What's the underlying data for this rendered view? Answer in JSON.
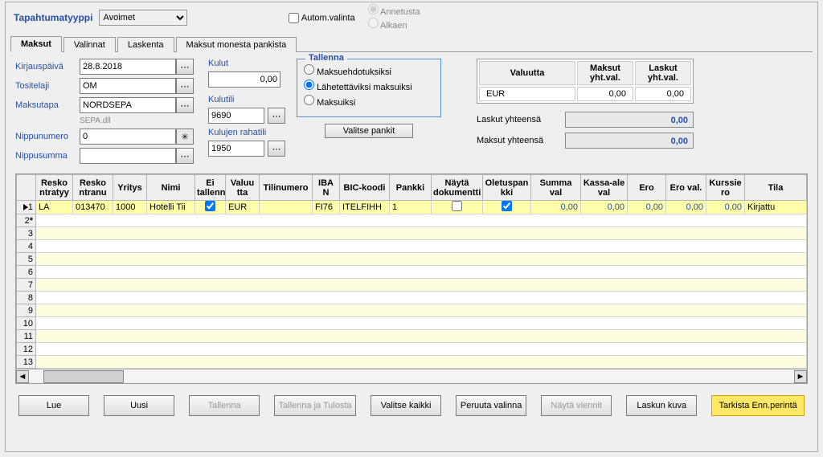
{
  "top": {
    "type_label": "Tapahtumatyyppi",
    "type_value": "Avoimet",
    "autoselect": "Autom.valinta",
    "radio1": "Annetusta",
    "radio2": "Alkaen"
  },
  "tabs": [
    "Maksut",
    "Valinnat",
    "Laskenta",
    "Maksut monesta pankista"
  ],
  "form": {
    "kirjauspaiva_label": "Kirjauspäivä",
    "kirjauspaiva": "28.8.2018",
    "tositelaji_label": "Tositelaji",
    "tositelaji": "OM",
    "maksutapa_label": "Maksutapa",
    "maksutapa": "NORDSEPA",
    "maksutapa_sub": "SEPA.dll",
    "nippunumero_label": "Nippunumero",
    "nippunumero": "0",
    "nippusumma_label": "Nippusumma",
    "nippusumma": "",
    "kulut_label": "Kulut",
    "kulut": "0,00",
    "kulutili_label": "Kulutili",
    "kulutili": "9690",
    "kulujen_rahatili_label": "Kulujen rahatili",
    "kulujen_rahatili": "1950",
    "valitse_pankit": "Valitse pankit",
    "tallenna_legend": "Tallenna",
    "opt1": "Maksuehdotuksiksi",
    "opt2": "Lähetettäviksi maksuiksi",
    "opt3": "Maksuiksi",
    "currency_hdr": [
      "Valuutta",
      "Maksut yht.val.",
      "Laskut yht.val."
    ],
    "currency_row": [
      "EUR",
      "0,00",
      "0,00"
    ],
    "laskut_yht_label": "Laskut yhteensä",
    "laskut_yht": "0,00",
    "maksut_yht_label": "Maksut yhteensä",
    "maksut_yht": "0,00"
  },
  "grid": {
    "headers": [
      "Resko ntratyy",
      "Resko ntranu",
      "Yritys",
      "Nimi",
      "Ei tallenn",
      "Valuu tta",
      "Tilinumero",
      "IBA N",
      "BIC-koodi",
      "Pankki",
      "Näytä dokumentti",
      "Oletuspan kki",
      "Summa val",
      "Kassa-ale val",
      "Ero",
      "Ero val.",
      "Kurssie ro",
      "Tila"
    ],
    "row1": {
      "reskontratyy": "LA",
      "reskontranu": "013470",
      "yritys": "1000",
      "nimi": "Hotelli Tii",
      "eitallenn": true,
      "valuutta": "EUR",
      "tilinumero": "",
      "iban": "FI76",
      "bic": "ITELFIHH",
      "pankki": "1",
      "naytadok": false,
      "oletuspankki": true,
      "summaval": "0,00",
      "kassaale": "0,00",
      "ero": "0,00",
      "eroval": "0,00",
      "kurssiero": "0,00",
      "tila": "Kirjattu"
    }
  },
  "buttons": {
    "lue": "Lue",
    "uusi": "Uusi",
    "tallenna": "Tallenna",
    "tallenna_tulosta": "Tallenna ja Tulosta",
    "valitse_kaikki": "Valitse kaikki",
    "peruuta": "Peruuta valinna",
    "nayta_viennit": "Näytä viennit",
    "laskun_kuva": "Laskun kuva",
    "tarkista": "Tarkista Enn.perintä"
  }
}
